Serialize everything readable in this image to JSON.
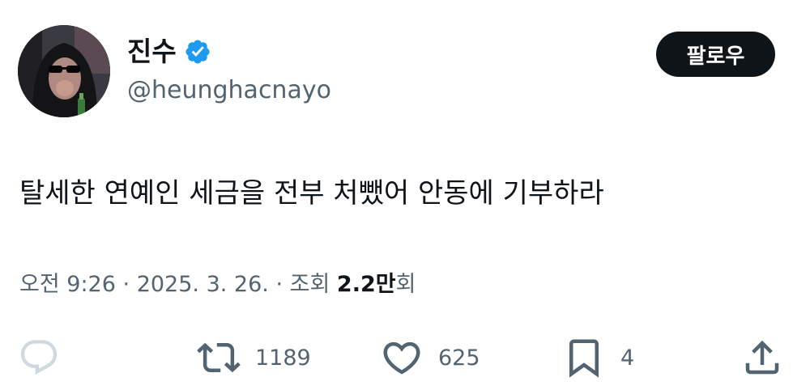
{
  "author": {
    "display_name": "진수",
    "handle": "@heunghacnayo",
    "verified": true
  },
  "follow_button": {
    "label": "팔로우"
  },
  "tweet": {
    "text": "탈세한 연예인 세금을 전부 처뺐어 안동에 기부하라"
  },
  "meta": {
    "time": "오전 9:26",
    "separator": "·",
    "date": "2025. 3. 26.",
    "views_label": "조회",
    "views_count": "2.2만",
    "views_suffix": "회"
  },
  "actions": {
    "reply_count": "",
    "retweet_count": "1189",
    "like_count": "625",
    "bookmark_count": "4"
  },
  "colors": {
    "text_primary": "#0f1419",
    "text_secondary": "#536471",
    "verified_blue": "#1d9bf0",
    "button_bg": "#0f1419",
    "icon_color": "#536471"
  },
  "icons": {
    "verified": "verified-badge-icon",
    "reply": "reply-icon",
    "retweet": "retweet-icon",
    "like": "heart-icon",
    "bookmark": "bookmark-icon",
    "share": "share-icon"
  }
}
